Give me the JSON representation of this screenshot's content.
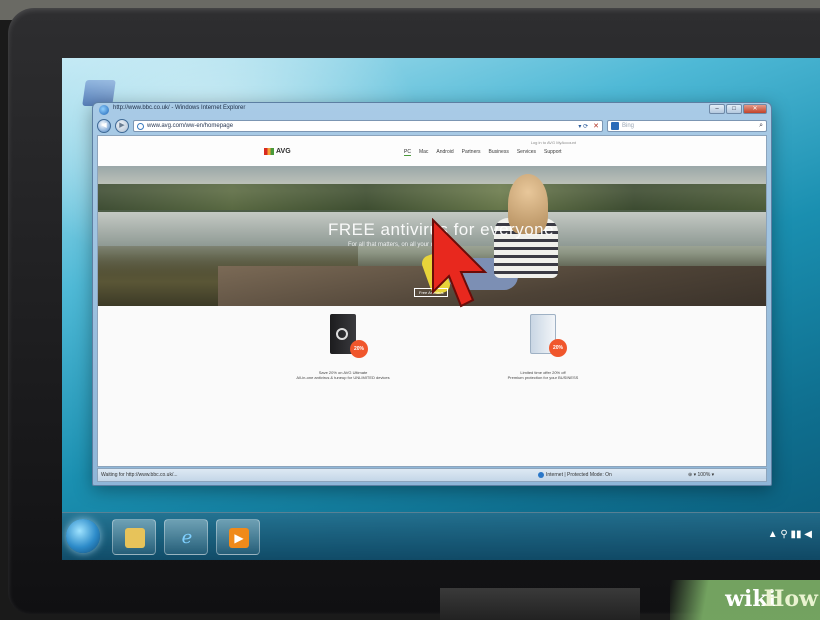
{
  "window": {
    "title": "http://www.bbc.co.uk/ - Windows Internet Explorer",
    "controls": {
      "minimize": "–",
      "maximize": "□",
      "close": "✕"
    }
  },
  "navigation": {
    "back_icon": "back-arrow-icon",
    "forward_icon": "forward-arrow-icon",
    "address": "www.avg.com/ww-en/homepage",
    "address_go": "▾ ⟳",
    "address_stop": "✕",
    "search_placeholder": "Bing",
    "search_icon": "⌕"
  },
  "site": {
    "logo": "AVG",
    "top_link": "Log in to AVG MyAccount",
    "nav": [
      "PC",
      "Mac",
      "Android",
      "Partners",
      "Business",
      "Services",
      "Support"
    ],
    "hero_title": "FREE antivirus for everyone",
    "hero_subtitle": "For all that matters, on all your devices",
    "hero_button": "Free Antivirus",
    "products": [
      {
        "badge": "20%",
        "line1": "Save 20% on AVG Ultimate",
        "line2": "All-in-one antivirus & tuneup for UNLIMITED devices"
      },
      {
        "badge": "20%",
        "line1": "Limited time offer 20% off",
        "line2": "Premium protection for your BUSINESS"
      }
    ]
  },
  "statusbar": {
    "status": "Waiting for http://www.bbc.co.uk/...",
    "zone": "Internet | Protected Mode: On",
    "zoom": "⊕ ▾  100% ▾"
  },
  "taskbar": {
    "items": [
      "explorer",
      "internet-explorer",
      "media-player"
    ],
    "tray": "▲  ⚲  ▮▮ ◀"
  },
  "watermark": {
    "part1": "wiki",
    "part2": "How"
  },
  "colors": {
    "cursor": "#e8281e",
    "accent_green": "#4a9a3a",
    "badge": "#f0562c"
  }
}
